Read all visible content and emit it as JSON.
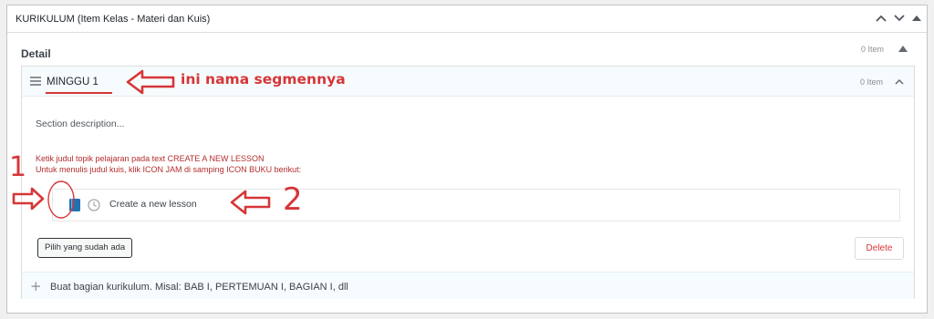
{
  "metabox": {
    "title": "KURIKULUM (Item Kelas - Materi dan Kuis)",
    "controls": [
      "chevron-up-icon",
      "chevron-down-icon",
      "caret-up-icon"
    ]
  },
  "detail": {
    "label": "Detail",
    "count": "0 Item"
  },
  "section": {
    "name": "MINGGU 1",
    "count": "0 Item",
    "description": "Section description...",
    "notes": [
      "Ketik judul topik pelajaran pada text CREATE A NEW LESSON",
      "Untuk menulis judul kuis, klik ICON JAM di samping ICON BUKU berikut:"
    ],
    "lesson_placeholder": "Create a new lesson",
    "select_existing_label": "Pilih yang sudah ada",
    "delete_label": "Delete"
  },
  "add_section": {
    "placeholder": "Buat bagian kurikulum. Misal: BAB I, PERTEMUAN I, BAGIAN I, dll"
  },
  "annotations": {
    "segment_note": "ini nama segmennya",
    "marker_1": "1",
    "marker_2": "2"
  },
  "colors": {
    "annotation": "#d63638",
    "note_text": "#b32d2e",
    "book_icon": "#2271b1",
    "section_header_bg": "#f6fbfd"
  }
}
